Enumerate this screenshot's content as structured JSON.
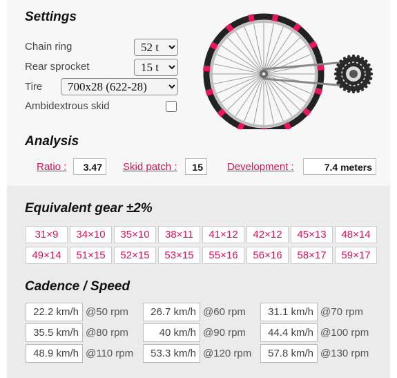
{
  "settings": {
    "heading": "Settings",
    "chain_ring_label": "Chain ring",
    "chain_ring_value": "52 t",
    "rear_sprocket_label": "Rear sprocket",
    "rear_sprocket_value": "15 t",
    "tire_label": "Tire",
    "tire_value": "700x28 (622-28)",
    "ambidextrous_label": "Ambidextrous skid",
    "ambidextrous_checked": false
  },
  "analysis": {
    "heading": "Analysis",
    "ratio_label": "Ratio :",
    "ratio_value": "3.47",
    "skid_label": "Skid patch :",
    "skid_value": "15",
    "development_label": "Development :",
    "development_value": "7.4 meters"
  },
  "equivalent": {
    "heading": "Equivalent gear ±2%",
    "gears": [
      "31×9",
      "34×10",
      "35×10",
      "38×11",
      "41×12",
      "42×12",
      "45×13",
      "48×14",
      "49×14",
      "51×15",
      "52×15",
      "53×15",
      "55×16",
      "56×16",
      "58×17",
      "59×17"
    ]
  },
  "cadence": {
    "heading": "Cadence / Speed",
    "rows": [
      {
        "speed": "22.2 km/h",
        "rpm": "@50 rpm"
      },
      {
        "speed": "26.7 km/h",
        "rpm": "@60 rpm"
      },
      {
        "speed": "31.1 km/h",
        "rpm": "@70 rpm"
      },
      {
        "speed": "35.5 km/h",
        "rpm": "@80 rpm"
      },
      {
        "speed": "40 km/h",
        "rpm": "@90 rpm"
      },
      {
        "speed": "44.4 km/h",
        "rpm": "@100 rpm"
      },
      {
        "speed": "48.9 km/h",
        "rpm": "@110 rpm"
      },
      {
        "speed": "53.3 km/h",
        "rpm": "@120 rpm"
      },
      {
        "speed": "57.8 km/h",
        "rpm": "@130 rpm"
      }
    ]
  },
  "illustration": {
    "accent_color": "#e8175d",
    "skid_marks": 15,
    "spokes": 32
  }
}
